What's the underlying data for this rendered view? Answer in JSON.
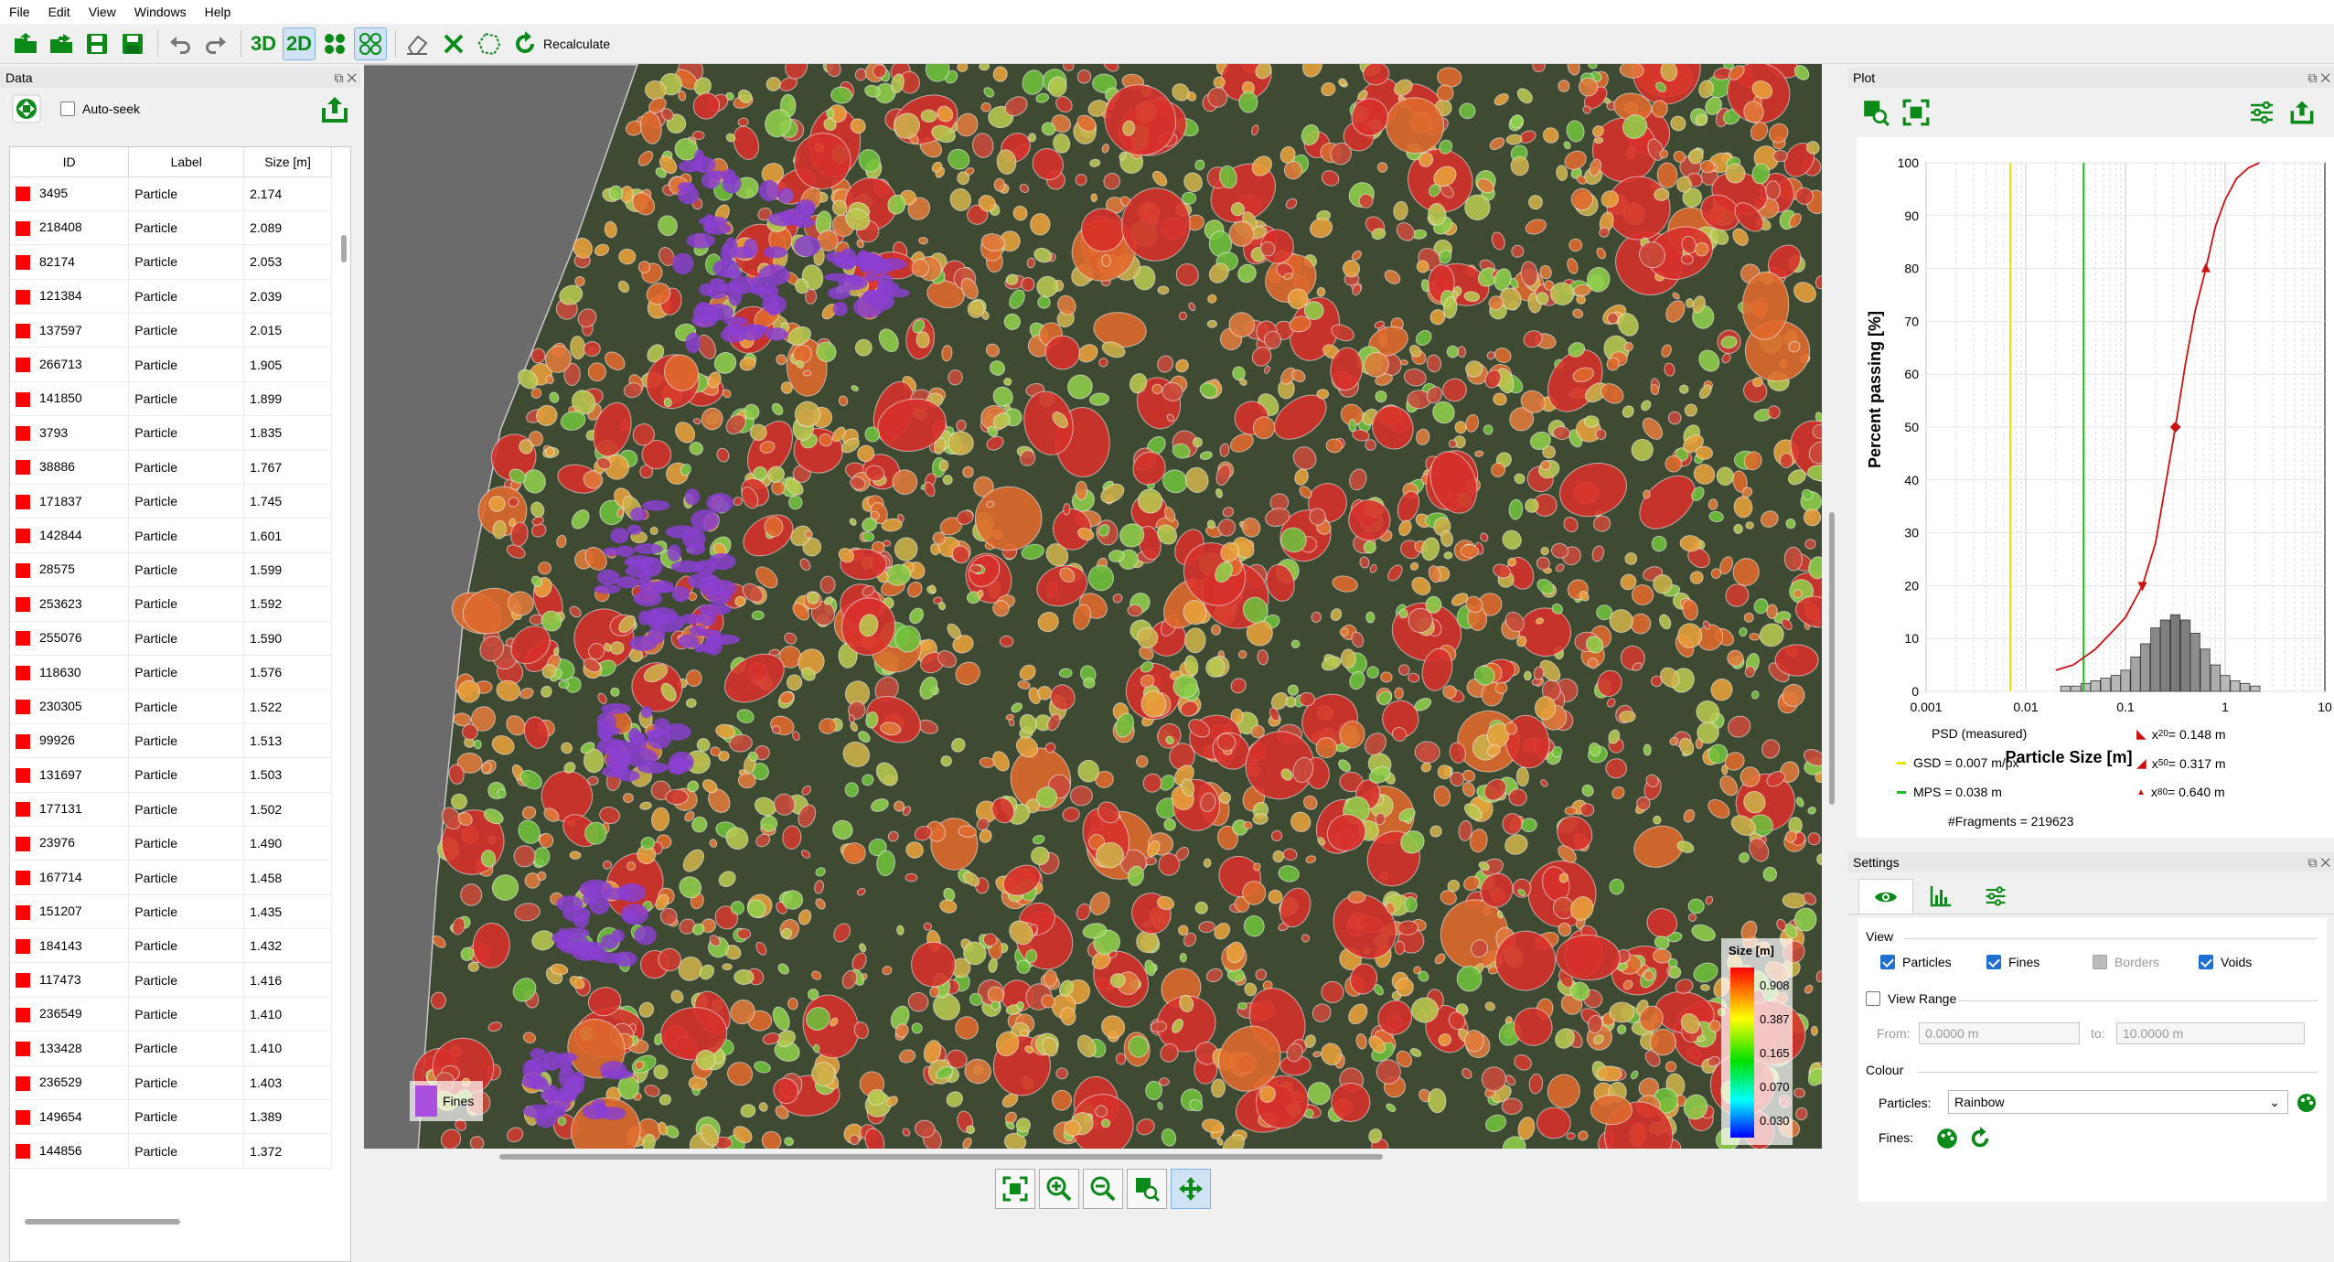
{
  "menu": [
    "File",
    "Edit",
    "View",
    "Windows",
    "Help"
  ],
  "toolbar": {
    "label_3d": "3D",
    "label_2d": "2D",
    "recalculate": "Recalculate"
  },
  "data_panel": {
    "title": "Data",
    "auto_seek": "Auto-seek",
    "columns": [
      "ID",
      "Label",
      "Size [m]"
    ],
    "rows": [
      [
        "3495",
        "Particle",
        "2.174"
      ],
      [
        "218408",
        "Particle",
        "2.089"
      ],
      [
        "82174",
        "Particle",
        "2.053"
      ],
      [
        "121384",
        "Particle",
        "2.039"
      ],
      [
        "137597",
        "Particle",
        "2.015"
      ],
      [
        "266713",
        "Particle",
        "1.905"
      ],
      [
        "141850",
        "Particle",
        "1.899"
      ],
      [
        "3793",
        "Particle",
        "1.835"
      ],
      [
        "38886",
        "Particle",
        "1.767"
      ],
      [
        "171837",
        "Particle",
        "1.745"
      ],
      [
        "142844",
        "Particle",
        "1.601"
      ],
      [
        "28575",
        "Particle",
        "1.599"
      ],
      [
        "253623",
        "Particle",
        "1.592"
      ],
      [
        "255076",
        "Particle",
        "1.590"
      ],
      [
        "118630",
        "Particle",
        "1.576"
      ],
      [
        "230305",
        "Particle",
        "1.522"
      ],
      [
        "99926",
        "Particle",
        "1.513"
      ],
      [
        "131697",
        "Particle",
        "1.503"
      ],
      [
        "177131",
        "Particle",
        "1.502"
      ],
      [
        "23976",
        "Particle",
        "1.490"
      ],
      [
        "167714",
        "Particle",
        "1.458"
      ],
      [
        "151207",
        "Particle",
        "1.435"
      ],
      [
        "184143",
        "Particle",
        "1.432"
      ],
      [
        "117473",
        "Particle",
        "1.416"
      ],
      [
        "236549",
        "Particle",
        "1.410"
      ],
      [
        "133428",
        "Particle",
        "1.410"
      ],
      [
        "236529",
        "Particle",
        "1.403"
      ],
      [
        "149654",
        "Particle",
        "1.389"
      ],
      [
        "144856",
        "Particle",
        "1.372"
      ]
    ]
  },
  "viewer": {
    "fines_label": "Fines",
    "size_legend_title": "Size [m]",
    "size_ticks": [
      "0.908",
      "0.387",
      "0.165",
      "0.070",
      "0.030"
    ]
  },
  "plot_panel": {
    "title": "Plot",
    "chart_data": {
      "type": "line",
      "xlabel": "Particle Size [m]",
      "ylabel": "Percent passing [%]",
      "x_scale": "log",
      "xlim": [
        0.001,
        10
      ],
      "ylim": [
        0,
        100
      ],
      "x_ticks": [
        "0.001",
        "0.01",
        "0.1",
        "1",
        "10"
      ],
      "y_ticks": [
        "0",
        "10",
        "20",
        "30",
        "40",
        "50",
        "60",
        "70",
        "80",
        "90",
        "100"
      ],
      "series": [
        {
          "name": "PSD (measured)",
          "color": "#cc1111",
          "x": [
            0.02,
            0.03,
            0.05,
            0.08,
            0.1,
            0.148,
            0.2,
            0.317,
            0.4,
            0.5,
            0.64,
            0.8,
            1.0,
            1.3,
            1.7,
            2.2
          ],
          "y": [
            4,
            5,
            8,
            12,
            14,
            20,
            28,
            50,
            62,
            72,
            80,
            88,
            93,
            97,
            99,
            100
          ]
        }
      ],
      "histogram": {
        "x": [
          0.025,
          0.032,
          0.04,
          0.05,
          0.063,
          0.08,
          0.1,
          0.126,
          0.158,
          0.2,
          0.25,
          0.316,
          0.4,
          0.5,
          0.63,
          0.8,
          1.0,
          1.26,
          1.58,
          2.0
        ],
        "y": [
          1,
          1,
          1.5,
          2,
          2.5,
          3,
          4,
          6.5,
          9,
          12,
          13.5,
          14.5,
          13.5,
          11,
          8,
          5,
          3,
          2,
          1.5,
          1
        ]
      },
      "vertical_lines": [
        {
          "name": "GSD = 0.007 m/px",
          "x": 0.007,
          "color": "#e6e600"
        },
        {
          "name": "MPS = 0.038 m",
          "x": 0.038,
          "color": "#22bb22"
        }
      ],
      "markers": [
        {
          "label": "x20 = 0.148 m",
          "x": 0.148,
          "y": 20
        },
        {
          "label": "x50 = 0.317 m",
          "x": 0.317,
          "y": 50
        },
        {
          "label": "x80 = 0.640 m",
          "x": 0.64,
          "y": 80
        }
      ],
      "legend": {
        "psd": "PSD (measured)",
        "gsd": "GSD = 0.007 m/px",
        "mps": "MPS = 0.038 m",
        "fragments": "#Fragments = 219623",
        "x20_sym": "x",
        "x20_sub": "20",
        "x20_val": " = 0.148 m",
        "x50_sym": "x",
        "x50_sub": "50",
        "x50_val": " = 0.317 m",
        "x80_sym": "x",
        "x80_sub": "80",
        "x80_val": " = 0.640 m"
      }
    }
  },
  "settings_panel": {
    "title": "Settings",
    "view_group": "View",
    "particles": "Particles",
    "fines": "Fines",
    "borders": "Borders",
    "voids": "Voids",
    "view_range": "View Range",
    "from_label": "From:",
    "from_value": "0.0000 m",
    "to_label": "to:",
    "to_value": "10.0000 m",
    "colour_group": "Colour",
    "particles_colour_label": "Particles:",
    "particles_colour_value": "Rainbow",
    "fines_colour_label": "Fines:"
  },
  "colors": {
    "accent_green": "#0b8a1a",
    "fines_purple": "#a94fe0",
    "particle_red": "#ff0000"
  }
}
